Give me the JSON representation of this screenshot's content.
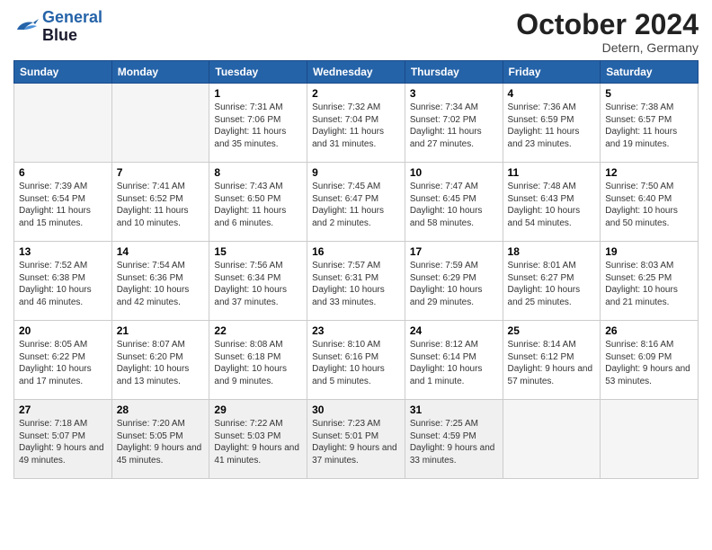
{
  "logo": {
    "line1": "General",
    "line2": "Blue"
  },
  "title": "October 2024",
  "location": "Detern, Germany",
  "weekdays": [
    "Sunday",
    "Monday",
    "Tuesday",
    "Wednesday",
    "Thursday",
    "Friday",
    "Saturday"
  ],
  "weeks": [
    [
      {
        "day": "",
        "info": ""
      },
      {
        "day": "",
        "info": ""
      },
      {
        "day": "1",
        "info": "Sunrise: 7:31 AM\nSunset: 7:06 PM\nDaylight: 11 hours\nand 35 minutes."
      },
      {
        "day": "2",
        "info": "Sunrise: 7:32 AM\nSunset: 7:04 PM\nDaylight: 11 hours\nand 31 minutes."
      },
      {
        "day": "3",
        "info": "Sunrise: 7:34 AM\nSunset: 7:02 PM\nDaylight: 11 hours\nand 27 minutes."
      },
      {
        "day": "4",
        "info": "Sunrise: 7:36 AM\nSunset: 6:59 PM\nDaylight: 11 hours\nand 23 minutes."
      },
      {
        "day": "5",
        "info": "Sunrise: 7:38 AM\nSunset: 6:57 PM\nDaylight: 11 hours\nand 19 minutes."
      }
    ],
    [
      {
        "day": "6",
        "info": "Sunrise: 7:39 AM\nSunset: 6:54 PM\nDaylight: 11 hours\nand 15 minutes."
      },
      {
        "day": "7",
        "info": "Sunrise: 7:41 AM\nSunset: 6:52 PM\nDaylight: 11 hours\nand 10 minutes."
      },
      {
        "day": "8",
        "info": "Sunrise: 7:43 AM\nSunset: 6:50 PM\nDaylight: 11 hours\nand 6 minutes."
      },
      {
        "day": "9",
        "info": "Sunrise: 7:45 AM\nSunset: 6:47 PM\nDaylight: 11 hours\nand 2 minutes."
      },
      {
        "day": "10",
        "info": "Sunrise: 7:47 AM\nSunset: 6:45 PM\nDaylight: 10 hours\nand 58 minutes."
      },
      {
        "day": "11",
        "info": "Sunrise: 7:48 AM\nSunset: 6:43 PM\nDaylight: 10 hours\nand 54 minutes."
      },
      {
        "day": "12",
        "info": "Sunrise: 7:50 AM\nSunset: 6:40 PM\nDaylight: 10 hours\nand 50 minutes."
      }
    ],
    [
      {
        "day": "13",
        "info": "Sunrise: 7:52 AM\nSunset: 6:38 PM\nDaylight: 10 hours\nand 46 minutes."
      },
      {
        "day": "14",
        "info": "Sunrise: 7:54 AM\nSunset: 6:36 PM\nDaylight: 10 hours\nand 42 minutes."
      },
      {
        "day": "15",
        "info": "Sunrise: 7:56 AM\nSunset: 6:34 PM\nDaylight: 10 hours\nand 37 minutes."
      },
      {
        "day": "16",
        "info": "Sunrise: 7:57 AM\nSunset: 6:31 PM\nDaylight: 10 hours\nand 33 minutes."
      },
      {
        "day": "17",
        "info": "Sunrise: 7:59 AM\nSunset: 6:29 PM\nDaylight: 10 hours\nand 29 minutes."
      },
      {
        "day": "18",
        "info": "Sunrise: 8:01 AM\nSunset: 6:27 PM\nDaylight: 10 hours\nand 25 minutes."
      },
      {
        "day": "19",
        "info": "Sunrise: 8:03 AM\nSunset: 6:25 PM\nDaylight: 10 hours\nand 21 minutes."
      }
    ],
    [
      {
        "day": "20",
        "info": "Sunrise: 8:05 AM\nSunset: 6:22 PM\nDaylight: 10 hours\nand 17 minutes."
      },
      {
        "day": "21",
        "info": "Sunrise: 8:07 AM\nSunset: 6:20 PM\nDaylight: 10 hours\nand 13 minutes."
      },
      {
        "day": "22",
        "info": "Sunrise: 8:08 AM\nSunset: 6:18 PM\nDaylight: 10 hours\nand 9 minutes."
      },
      {
        "day": "23",
        "info": "Sunrise: 8:10 AM\nSunset: 6:16 PM\nDaylight: 10 hours\nand 5 minutes."
      },
      {
        "day": "24",
        "info": "Sunrise: 8:12 AM\nSunset: 6:14 PM\nDaylight: 10 hours\nand 1 minute."
      },
      {
        "day": "25",
        "info": "Sunrise: 8:14 AM\nSunset: 6:12 PM\nDaylight: 9 hours\nand 57 minutes."
      },
      {
        "day": "26",
        "info": "Sunrise: 8:16 AM\nSunset: 6:09 PM\nDaylight: 9 hours\nand 53 minutes."
      }
    ],
    [
      {
        "day": "27",
        "info": "Sunrise: 7:18 AM\nSunset: 5:07 PM\nDaylight: 9 hours\nand 49 minutes."
      },
      {
        "day": "28",
        "info": "Sunrise: 7:20 AM\nSunset: 5:05 PM\nDaylight: 9 hours\nand 45 minutes."
      },
      {
        "day": "29",
        "info": "Sunrise: 7:22 AM\nSunset: 5:03 PM\nDaylight: 9 hours\nand 41 minutes."
      },
      {
        "day": "30",
        "info": "Sunrise: 7:23 AM\nSunset: 5:01 PM\nDaylight: 9 hours\nand 37 minutes."
      },
      {
        "day": "31",
        "info": "Sunrise: 7:25 AM\nSunset: 4:59 PM\nDaylight: 9 hours\nand 33 minutes."
      },
      {
        "day": "",
        "info": ""
      },
      {
        "day": "",
        "info": ""
      }
    ]
  ]
}
